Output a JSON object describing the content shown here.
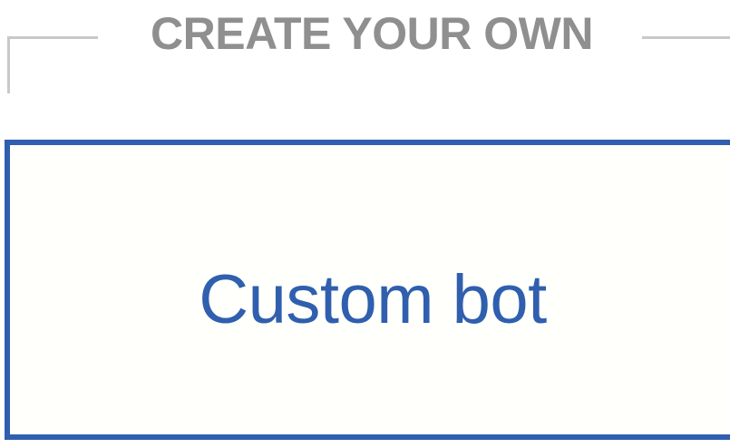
{
  "section": {
    "title": "CREATE YOUR OWN"
  },
  "options": [
    {
      "label": "Custom bot"
    }
  ],
  "colors": {
    "accent": "#2f5fae",
    "heading": "#8f8f8f",
    "divider": "#c9c9c9",
    "card_background": "#fffffc"
  }
}
